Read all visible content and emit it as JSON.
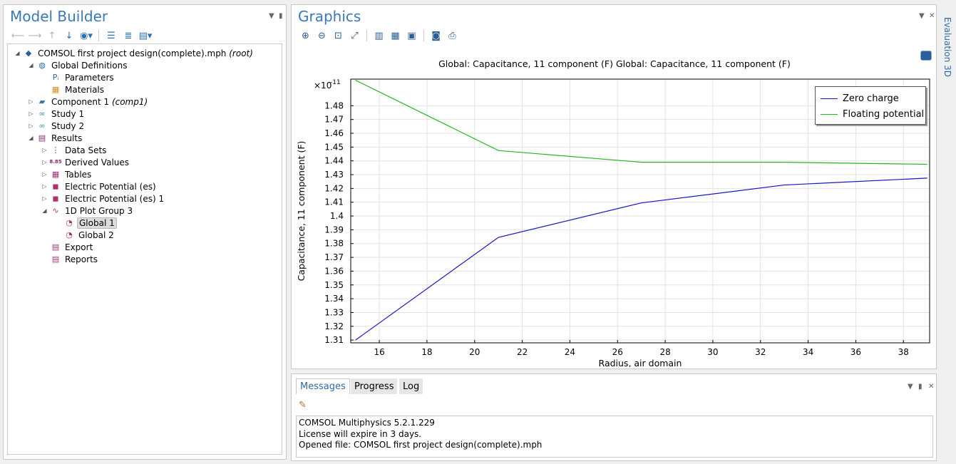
{
  "model_builder": {
    "title": "Model Builder",
    "tree": [
      {
        "label": "COMSOL first project design(complete).mph",
        "suffix": "(root)",
        "icon": "root-file-icon",
        "level": 0,
        "expander": "open"
      },
      {
        "label": "Global Definitions",
        "icon": "globe-icon",
        "level": 1,
        "expander": "open"
      },
      {
        "label": "Parameters",
        "icon": "parameters-icon",
        "level": 2,
        "expander": ""
      },
      {
        "label": "Materials",
        "icon": "materials-icon",
        "level": 2,
        "expander": ""
      },
      {
        "label": "Component 1",
        "suffix": "(comp1)",
        "icon": "component-icon",
        "level": 1,
        "expander": "closed"
      },
      {
        "label": "Study 1",
        "icon": "study-icon",
        "level": 1,
        "expander": "closed"
      },
      {
        "label": "Study 2",
        "icon": "study-icon",
        "level": 1,
        "expander": "closed"
      },
      {
        "label": "Results",
        "icon": "results-icon",
        "level": 1,
        "expander": "open"
      },
      {
        "label": "Data Sets",
        "icon": "datasets-icon",
        "level": 2,
        "expander": "closed"
      },
      {
        "label": "Derived Values",
        "icon": "derived-values-icon",
        "level": 2,
        "expander": "closed"
      },
      {
        "label": "Tables",
        "icon": "tables-icon",
        "level": 2,
        "expander": "closed"
      },
      {
        "label": "Electric Potential (es)",
        "icon": "plot-group-3d-icon",
        "level": 2,
        "expander": "closed"
      },
      {
        "label": "Electric Potential (es) 1",
        "icon": "plot-group-3d-icon",
        "level": 2,
        "expander": "closed"
      },
      {
        "label": "1D Plot Group 3",
        "icon": "plot-group-1d-icon",
        "level": 2,
        "expander": "open"
      },
      {
        "label": "Global 1",
        "icon": "global-plot-icon",
        "level": 3,
        "expander": "",
        "selected": true
      },
      {
        "label": "Global 2",
        "icon": "global-plot-icon",
        "level": 3,
        "expander": ""
      },
      {
        "label": "Export",
        "icon": "export-icon",
        "level": 2,
        "expander": ""
      },
      {
        "label": "Reports",
        "icon": "reports-icon",
        "level": 2,
        "expander": ""
      }
    ]
  },
  "graphics": {
    "title": "Graphics",
    "plot_title": "Global: Capacitance, 11 component (F)  Global: Capacitance, 11 component (F)"
  },
  "chart_data": {
    "type": "line",
    "title": "Global: Capacitance, 11 component (F)  Global: Capacitance, 11 component (F)",
    "xlabel": "Radius, air domain",
    "ylabel": "Capacitance, 11 component (F)",
    "y_exponent": "×10",
    "y_exponent_power": "-11",
    "xlim": [
      14.8,
      39.1
    ],
    "ylim": [
      1.308,
      1.4993
    ],
    "xticks": [
      16,
      18,
      20,
      22,
      24,
      26,
      28,
      30,
      32,
      34,
      36,
      38
    ],
    "yticks": [
      1.31,
      1.32,
      1.33,
      1.34,
      1.35,
      1.36,
      1.37,
      1.38,
      1.39,
      1.4,
      1.41,
      1.42,
      1.43,
      1.44,
      1.45,
      1.46,
      1.47,
      1.48
    ],
    "grid": true,
    "legend_position": "top-right",
    "series": [
      {
        "name": "Zero charge",
        "color": "#1515c8",
        "x": [
          15,
          21,
          27,
          33,
          39
        ],
        "y": [
          1.31,
          1.3845,
          1.4095,
          1.4225,
          1.4275
        ]
      },
      {
        "name": "Floating potential",
        "color": "#22b822",
        "x": [
          15,
          21,
          27,
          33,
          39
        ],
        "y": [
          1.4985,
          1.4475,
          1.439,
          1.439,
          1.4375
        ]
      }
    ]
  },
  "messages": {
    "tabs": [
      "Messages",
      "Progress",
      "Log"
    ],
    "lines": [
      "COMSOL Multiphysics 5.2.1.229",
      "License will expire in 3 days.",
      "Opened file: COMSOL first project design(complete).mph"
    ]
  },
  "side_tab": "Evaluation 3D",
  "colors": {
    "accent": "#3a79b8",
    "zero_charge": "#1515c8",
    "floating_potential": "#22b822"
  }
}
